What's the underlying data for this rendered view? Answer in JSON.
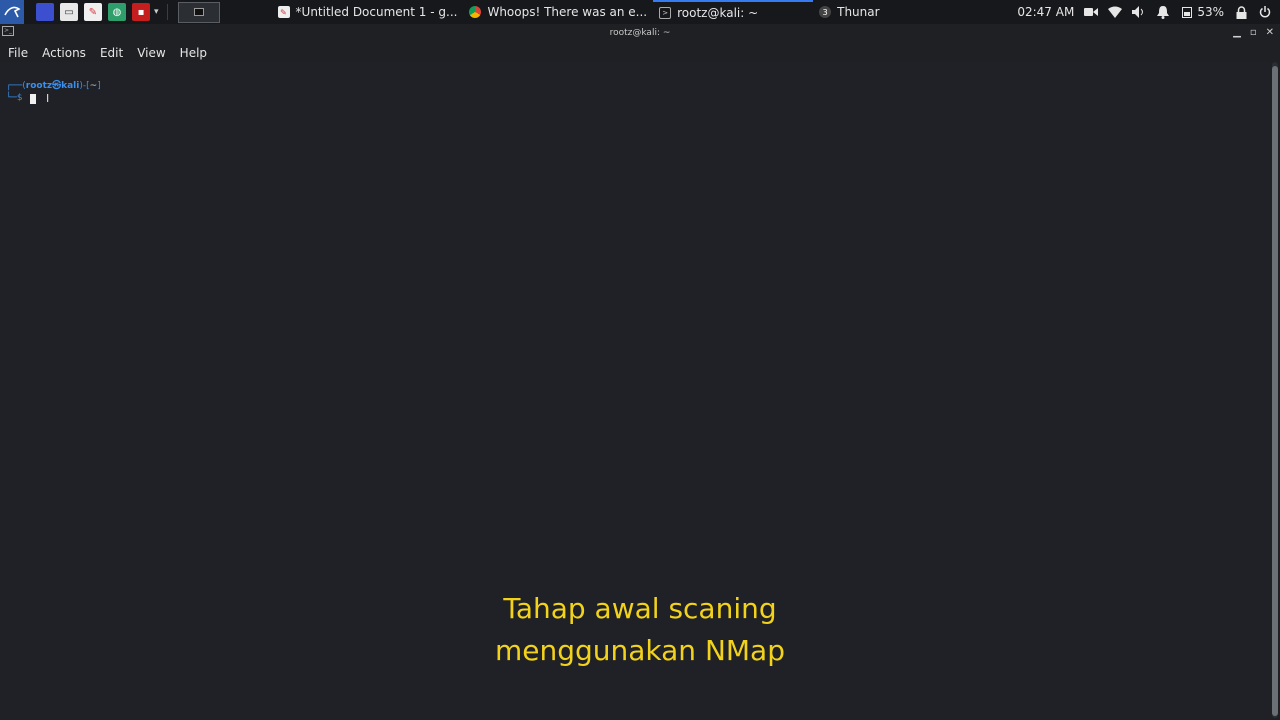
{
  "taskbar": {
    "tasks": [
      {
        "label": "*Untitled Document 1 - g...",
        "icon": "document-icon"
      },
      {
        "label": "Whoops! There was an e...",
        "icon": "chrome-icon"
      },
      {
        "label": "rootz@kali: ~",
        "icon": "terminal-icon",
        "active": true
      },
      {
        "label": "Thunar",
        "icon": "folder-icon",
        "badge": "3"
      }
    ],
    "clock": "02:47 AM",
    "battery": "53%"
  },
  "window": {
    "title": "rootz@kali: ~"
  },
  "menubar": {
    "items": [
      "File",
      "Actions",
      "Edit",
      "View",
      "Help"
    ]
  },
  "terminal": {
    "prompt_user": "rootz㉿kali",
    "prompt_path": "~",
    "prompt_symbol": "$"
  },
  "caption": {
    "line1": "Tahap awal scaning",
    "line2": "menggunakan NMap"
  },
  "colors": {
    "caption": "#f2d21b",
    "prompt": "#3b8eea",
    "background": "#1f2126",
    "accent": "#367bf0"
  }
}
